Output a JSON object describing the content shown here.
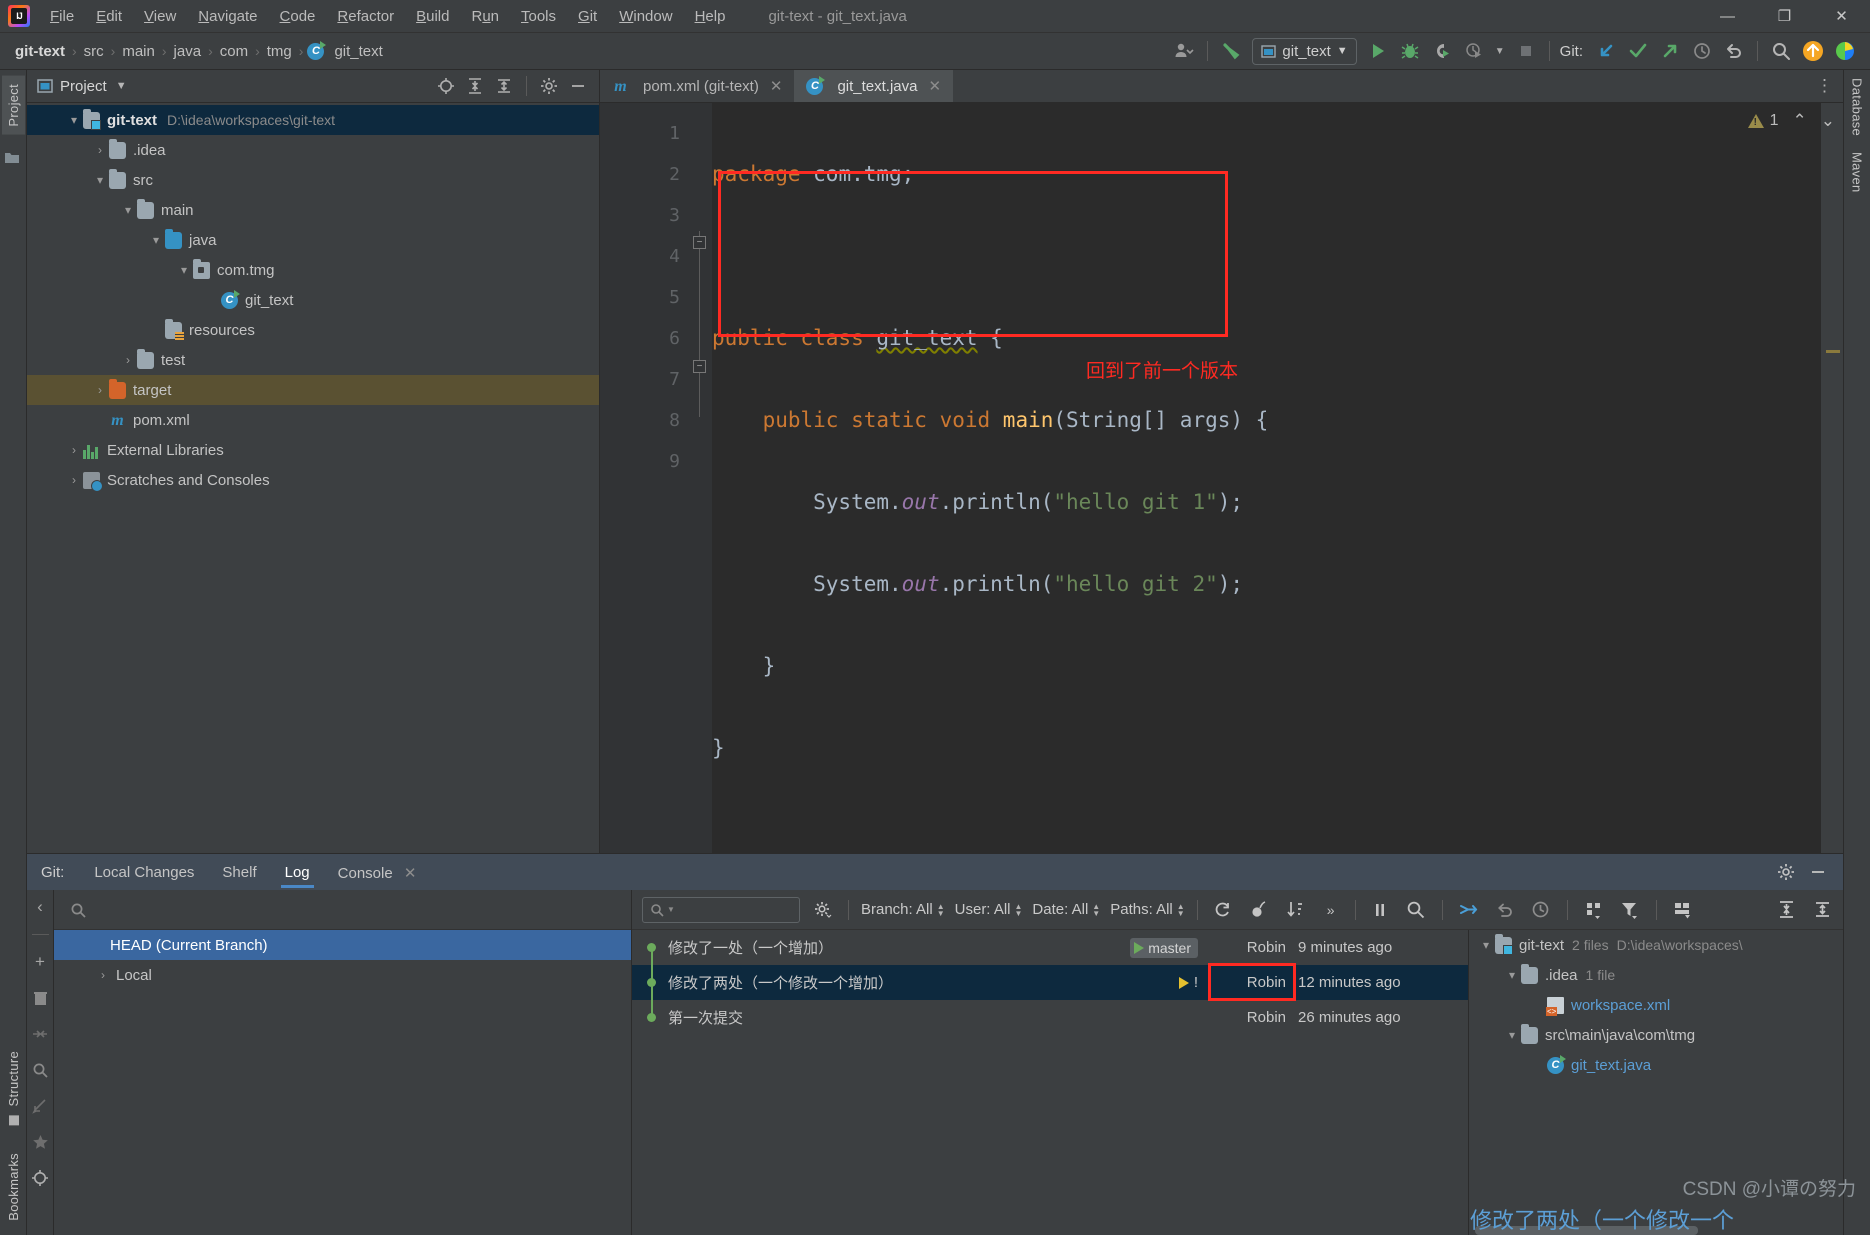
{
  "window": {
    "title": "git-text - git_text.java",
    "logo_text": "IJ",
    "minimize": "—",
    "maximize": "❐",
    "close": "✕"
  },
  "menubar": [
    {
      "label": "File"
    },
    {
      "label": "Edit"
    },
    {
      "label": "View"
    },
    {
      "label": "Navigate"
    },
    {
      "label": "Code"
    },
    {
      "label": "Refactor"
    },
    {
      "label": "Build"
    },
    {
      "label": "Run"
    },
    {
      "label": "Tools"
    },
    {
      "label": "Git"
    },
    {
      "label": "Window"
    },
    {
      "label": "Help"
    }
  ],
  "navbar": {
    "crumbs": [
      "git-text",
      "src",
      "main",
      "java",
      "com",
      "tmg",
      "git_text"
    ],
    "separator": "›",
    "run_config": "git_text",
    "git_label": "Git:",
    "icons": [
      {
        "name": "user-avatar-icon"
      },
      {
        "name": "hammer-build-icon"
      },
      {
        "name": "run-icon"
      },
      {
        "name": "debug-icon"
      },
      {
        "name": "run-coverage-icon"
      },
      {
        "name": "profiler-icon"
      },
      {
        "name": "stop-icon"
      },
      {
        "name": "git-pull-icon"
      },
      {
        "name": "git-commit-icon"
      },
      {
        "name": "git-push-icon"
      },
      {
        "name": "git-history-icon"
      },
      {
        "name": "git-rollback-icon"
      },
      {
        "name": "search-everywhere-icon"
      },
      {
        "name": "update-project-icon"
      }
    ]
  },
  "left_rail": {
    "tabs": [
      "Project"
    ],
    "bottom_tabs": [
      "Structure",
      "Bookmarks"
    ]
  },
  "right_rail": {
    "tabs": [
      "Database",
      "Maven"
    ]
  },
  "project_panel": {
    "title": "Project",
    "dropdown": "▾",
    "header_icons": [
      "locate-icon",
      "expand-all-icon",
      "collapse-all-icon",
      "gear-icon",
      "hide-icon"
    ],
    "tree": [
      {
        "depth": 0,
        "arrow": "⌄",
        "icon": "module",
        "label": "git-text",
        "bold": true,
        "path": "D:\\idea\\workspaces\\git-text",
        "state": "selected"
      },
      {
        "depth": 1,
        "arrow": "›",
        "icon": "folder",
        "label": ".idea",
        "path": "",
        "state": ""
      },
      {
        "depth": 1,
        "arrow": "⌄",
        "icon": "folder",
        "label": "src",
        "path": "",
        "state": ""
      },
      {
        "depth": 2,
        "arrow": "⌄",
        "icon": "folder",
        "label": "main",
        "path": "",
        "state": ""
      },
      {
        "depth": 3,
        "arrow": "⌄",
        "icon": "folder-blue",
        "label": "java",
        "path": "",
        "state": ""
      },
      {
        "depth": 4,
        "arrow": "⌄",
        "icon": "package",
        "label": "com.tmg",
        "path": "",
        "state": ""
      },
      {
        "depth": 5,
        "arrow": "",
        "icon": "class",
        "label": "git_text",
        "path": "",
        "state": ""
      },
      {
        "depth": 3,
        "arrow": "",
        "icon": "folder-resources",
        "label": "resources",
        "path": "",
        "state": ""
      },
      {
        "depth": 2,
        "arrow": "›",
        "icon": "folder",
        "label": "test",
        "path": "",
        "state": ""
      },
      {
        "depth": 1,
        "arrow": "›",
        "icon": "folder-orange",
        "label": "target",
        "path": "",
        "state": "warm"
      },
      {
        "depth": 1,
        "arrow": "",
        "icon": "maven",
        "label": "pom.xml",
        "path": "",
        "state": ""
      },
      {
        "depth": 0,
        "arrow": "›",
        "icon": "library",
        "label": "External Libraries",
        "path": "",
        "state": ""
      },
      {
        "depth": 0,
        "arrow": "›",
        "icon": "scratch",
        "label": "Scratches and Consoles",
        "path": "",
        "state": ""
      }
    ]
  },
  "editor": {
    "tabs": [
      {
        "label": "pom.xml (git-text)",
        "icon": "maven-icon",
        "active": false,
        "close": "✕"
      },
      {
        "label": "git_text.java",
        "icon": "java-class-icon",
        "active": true,
        "close": "✕"
      }
    ],
    "line_numbers": [
      "1",
      "2",
      "3",
      "4",
      "5",
      "6",
      "7",
      "8",
      "9"
    ],
    "warning_count": "1",
    "warning_up": "⌃",
    "warning_down": "⌄",
    "annotation_text": "回到了前一个版本",
    "annotation_color": "#ff2a22",
    "code_lines": [
      {
        "n": 1,
        "tokens": [
          {
            "t": "package ",
            "c": "kw"
          },
          {
            "t": "com.tmg;",
            "c": "pl"
          }
        ]
      },
      {
        "n": 2,
        "tokens": []
      },
      {
        "n": 3,
        "tokens": [
          {
            "t": "public class ",
            "c": "kw"
          },
          {
            "t": "git_text",
            "c": "warnu"
          },
          {
            "t": " {",
            "c": "pl"
          }
        ]
      },
      {
        "n": 4,
        "tokens": [
          {
            "t": "    public static void ",
            "c": "kw"
          },
          {
            "t": "main",
            "c": "mth"
          },
          {
            "t": "(String[] args) {",
            "c": "pl"
          }
        ]
      },
      {
        "n": 5,
        "tokens": [
          {
            "t": "        System.",
            "c": "pl"
          },
          {
            "t": "out",
            "c": "fld"
          },
          {
            "t": ".println(",
            "c": "pl"
          },
          {
            "t": "\"hello git 1\"",
            "c": "str"
          },
          {
            "t": ");",
            "c": "pl"
          }
        ]
      },
      {
        "n": 6,
        "tokens": [
          {
            "t": "        System.",
            "c": "pl"
          },
          {
            "t": "out",
            "c": "fld"
          },
          {
            "t": ".println(",
            "c": "pl"
          },
          {
            "t": "\"hello git 2\"",
            "c": "str"
          },
          {
            "t": ");",
            "c": "pl"
          }
        ]
      },
      {
        "n": 7,
        "tokens": [
          {
            "t": "    }",
            "c": "pl"
          }
        ]
      },
      {
        "n": 8,
        "tokens": [
          {
            "t": "}",
            "c": "pl"
          }
        ]
      },
      {
        "n": 9,
        "tokens": []
      }
    ]
  },
  "git_panel": {
    "title": "Git:",
    "tabs": [
      {
        "label": "Local Changes",
        "active": false
      },
      {
        "label": "Shelf",
        "active": false
      },
      {
        "label": "Log",
        "active": true
      },
      {
        "label": "Console",
        "active": false,
        "close": "✕"
      }
    ],
    "header_icons": [
      "gear-icon",
      "hide-icon"
    ],
    "branch_panel": {
      "collapse": "‹",
      "search_placeholder": "",
      "rows": [
        {
          "label": "HEAD (Current Branch)",
          "selected": true,
          "arrow": ""
        },
        {
          "label": "Local",
          "selected": false,
          "arrow": "›"
        }
      ],
      "rail_icons": [
        "add-icon",
        "delete-icon",
        "collapse-icon",
        "search-icon",
        "edit-icon",
        "favorite-icon",
        "locate-icon"
      ]
    },
    "log_toolbar": {
      "search_placeholder": "",
      "filters": [
        {
          "label": "Branch: All"
        },
        {
          "label": "User: All"
        },
        {
          "label": "Date: All"
        },
        {
          "label": "Paths: All"
        }
      ],
      "icons": [
        "refresh-icon",
        "cherry-pick-icon",
        "sort-icon",
        "more-icon",
        "pause-icon",
        "search-icon",
        "intellisort-icon",
        "undo-icon",
        "history-icon",
        "show-details-icon",
        "filter-icon",
        "layout-icon",
        "expand-all-icon",
        "collapse-all-icon"
      ]
    },
    "commits": [
      {
        "message": "修改了一处（一个增加）",
        "tag": "master",
        "tag_color": "green",
        "author": "Robin",
        "date": "9 minutes ago",
        "selected": false,
        "highlighted": false
      },
      {
        "message": "修改了两处（一个修改一个增加）",
        "tag": "!",
        "tag_color": "yellow",
        "author": "Robin",
        "date": "12 minutes ago",
        "selected": true,
        "highlighted": true
      },
      {
        "message": "第一次提交",
        "tag": "",
        "tag_color": "",
        "author": "Robin",
        "date": "26 minutes ago",
        "selected": false,
        "highlighted": false
      }
    ],
    "changed_files": [
      {
        "depth": 0,
        "arrow": "⌄",
        "icon": "module",
        "label": "git-text",
        "count": "2 files",
        "path": "D:\\idea\\workspaces\\",
        "is_file": false
      },
      {
        "depth": 1,
        "arrow": "⌄",
        "icon": "folder",
        "label": ".idea",
        "count": "1 file",
        "path": "",
        "is_file": false
      },
      {
        "depth": 2,
        "arrow": "",
        "icon": "xml",
        "label": "workspace.xml",
        "count": "",
        "path": "",
        "is_file": true
      },
      {
        "depth": 1,
        "arrow": "⌄",
        "icon": "folder",
        "label": "src\\main\\java\\com\\tmg",
        "count": "1 file",
        "path": "",
        "is_file": false
      },
      {
        "depth": 2,
        "arrow": "",
        "icon": "class",
        "label": "git_text.java",
        "count": "",
        "path": "",
        "is_file": true
      }
    ],
    "detail_message": "修改了两处（一个修改一个"
  },
  "watermark": "CSDN @小谭の努力"
}
